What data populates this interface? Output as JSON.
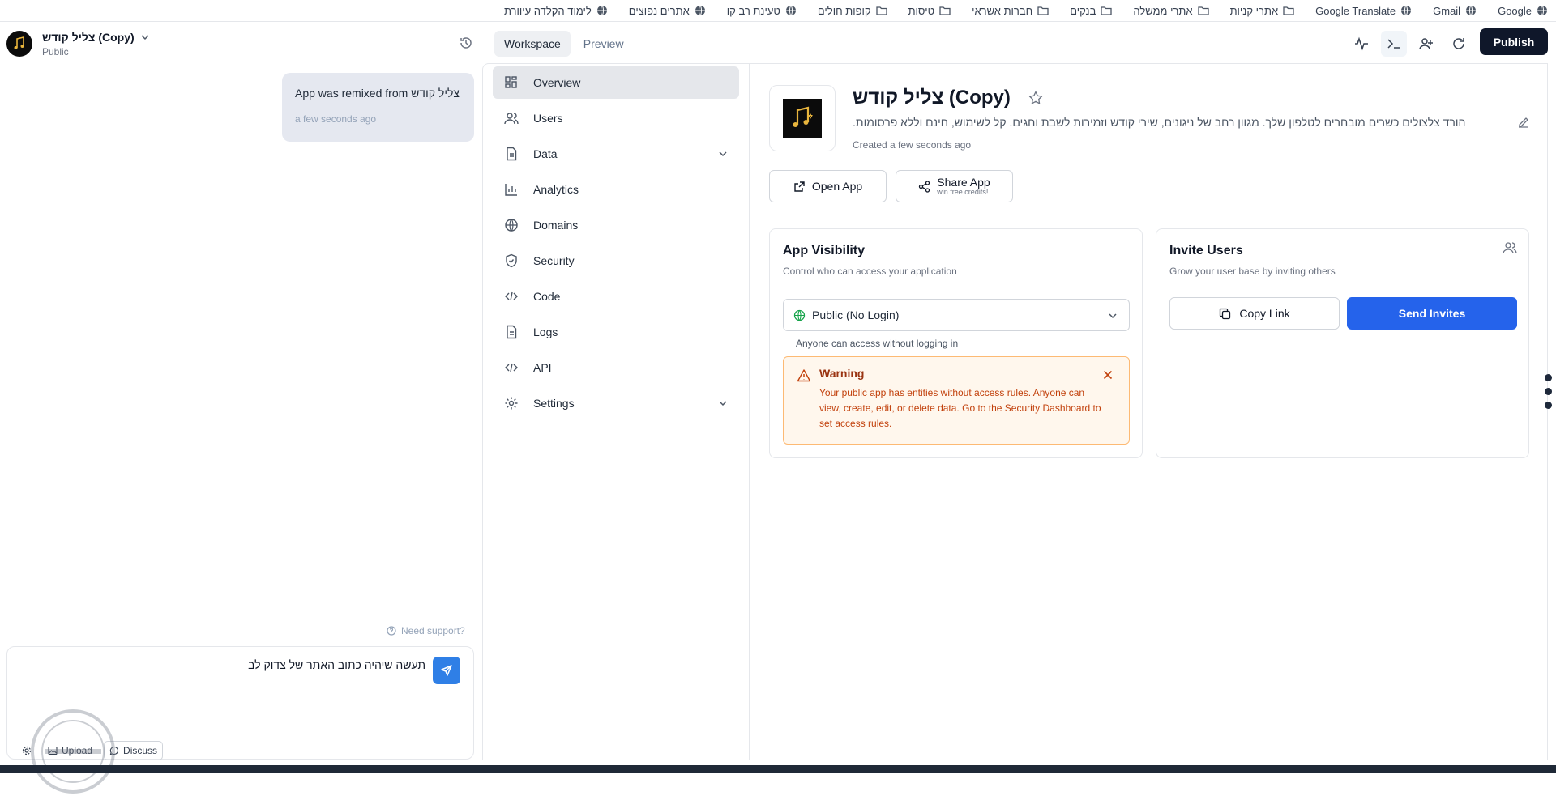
{
  "bookmarks": [
    {
      "label": "Google",
      "icon": "globe-icon"
    },
    {
      "label": "Gmail",
      "icon": "globe-icon"
    },
    {
      "label": "Google Translate",
      "icon": "globe-icon"
    },
    {
      "label": "אתרי קניות",
      "icon": "folder-icon"
    },
    {
      "label": "אתרי ממשלה",
      "icon": "folder-icon"
    },
    {
      "label": "בנקים",
      "icon": "folder-icon"
    },
    {
      "label": "חברות אשראי",
      "icon": "folder-icon"
    },
    {
      "label": "טיסות",
      "icon": "folder-icon"
    },
    {
      "label": "קופות חולים",
      "icon": "folder-icon"
    },
    {
      "label": "טעינת רב קו",
      "icon": "globe-icon"
    },
    {
      "label": "אתרים נפוצים",
      "icon": "globe-icon"
    },
    {
      "label": "לימוד הקלדה עיוורת",
      "icon": "globe-icon"
    }
  ],
  "header": {
    "app_name": "צליל קודש (Copy)",
    "app_visibility": "Public",
    "tabs": [
      {
        "label": "Workspace",
        "active": true
      },
      {
        "label": "Preview",
        "active": false
      }
    ],
    "publish_label": "Publish"
  },
  "chat": {
    "message": "App was remixed from צליל קודש",
    "message_time": "a few seconds ago",
    "support_label": "Need support?",
    "composer_value": "תעשה שיהיה כתוב האתר של צדוק לב",
    "upload_label": "Upload",
    "discuss_label": "Discuss"
  },
  "nav": {
    "items": [
      {
        "label": "Overview",
        "icon": "grid-icon",
        "active": true
      },
      {
        "label": "Users",
        "icon": "users-icon"
      },
      {
        "label": "Data",
        "icon": "file-icon",
        "expandable": true
      },
      {
        "label": "Analytics",
        "icon": "bar-chart-icon"
      },
      {
        "label": "Domains",
        "icon": "globe-icon"
      },
      {
        "label": "Security",
        "icon": "shield-icon"
      },
      {
        "label": "Code",
        "icon": "code-icon"
      },
      {
        "label": "Logs",
        "icon": "file-icon"
      },
      {
        "label": "API",
        "icon": "code-icon"
      },
      {
        "label": "Settings",
        "icon": "gear-icon",
        "expandable": true
      }
    ]
  },
  "overview": {
    "title": "צליל קודש (Copy)",
    "description": "הורד צלצולים כשרים מובחרים לטלפון שלך. מגוון רחב של ניגונים, שירי קודש וזמירות לשבת וחגים. קל לשימוש, חינם וללא פרסומות.",
    "created": "Created a few seconds ago",
    "open_app_label": "Open App",
    "share_app_label": "Share App",
    "share_app_sub": "win free credits!"
  },
  "visibility_card": {
    "title": "App Visibility",
    "subtitle": "Control who can access your application",
    "selected": "Public (No Login)",
    "help": "Anyone can access without logging in",
    "warning_title": "Warning",
    "warning_text": "Your public app has entities without access rules. Anyone can view, create, edit, or delete data. Go to the Security Dashboard to set access rules."
  },
  "invite_card": {
    "title": "Invite Users",
    "subtitle": "Grow your user base by inviting others",
    "copy_link_label": "Copy Link",
    "send_invites_label": "Send Invites"
  },
  "colors": {
    "primary": "#2563eb",
    "publish_bg": "#0f172a",
    "warning_bg": "#fff7ed",
    "warning_text": "#c2410c"
  }
}
